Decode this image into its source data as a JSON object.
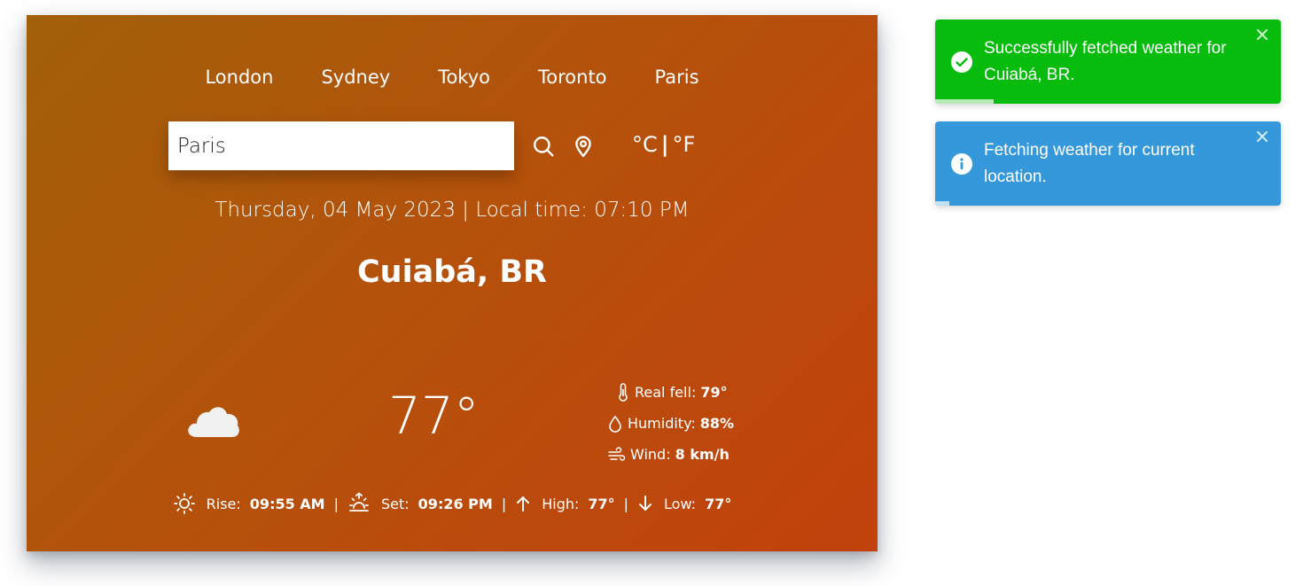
{
  "cities": [
    "London",
    "Sydney",
    "Tokyo",
    "Toronto",
    "Paris"
  ],
  "search": {
    "value": "Paris"
  },
  "units": {
    "celsius": "°C",
    "separator": "|",
    "fahrenheit": "°F"
  },
  "datetime": "Thursday, 04 May 2023 | Local time: 07:10 PM",
  "location": "Cuiabá, BR",
  "weather": {
    "icon": "cloud-icon",
    "temperature": "77°",
    "real_feel_label": "Real fell:",
    "real_feel": "79°",
    "humidity_label": "Humidity:",
    "humidity": "88%",
    "wind_label": "Wind:",
    "wind": "8 km/h"
  },
  "sun": {
    "rise_label": "Rise:",
    "rise": "09:55 AM",
    "set_label": "Set:",
    "set": "09:26 PM",
    "high_label": "High:",
    "high": "77°",
    "low_label": "Low:",
    "low": "77°",
    "separator": "|"
  },
  "toasts": [
    {
      "type": "success",
      "text": "Successfully fetched weather for Cuiabá, BR.",
      "color": "#07bc0c",
      "progress": 0.17
    },
    {
      "type": "info",
      "text": "Fetching weather for current location.",
      "color": "#3498db",
      "progress": 0.04
    }
  ]
}
